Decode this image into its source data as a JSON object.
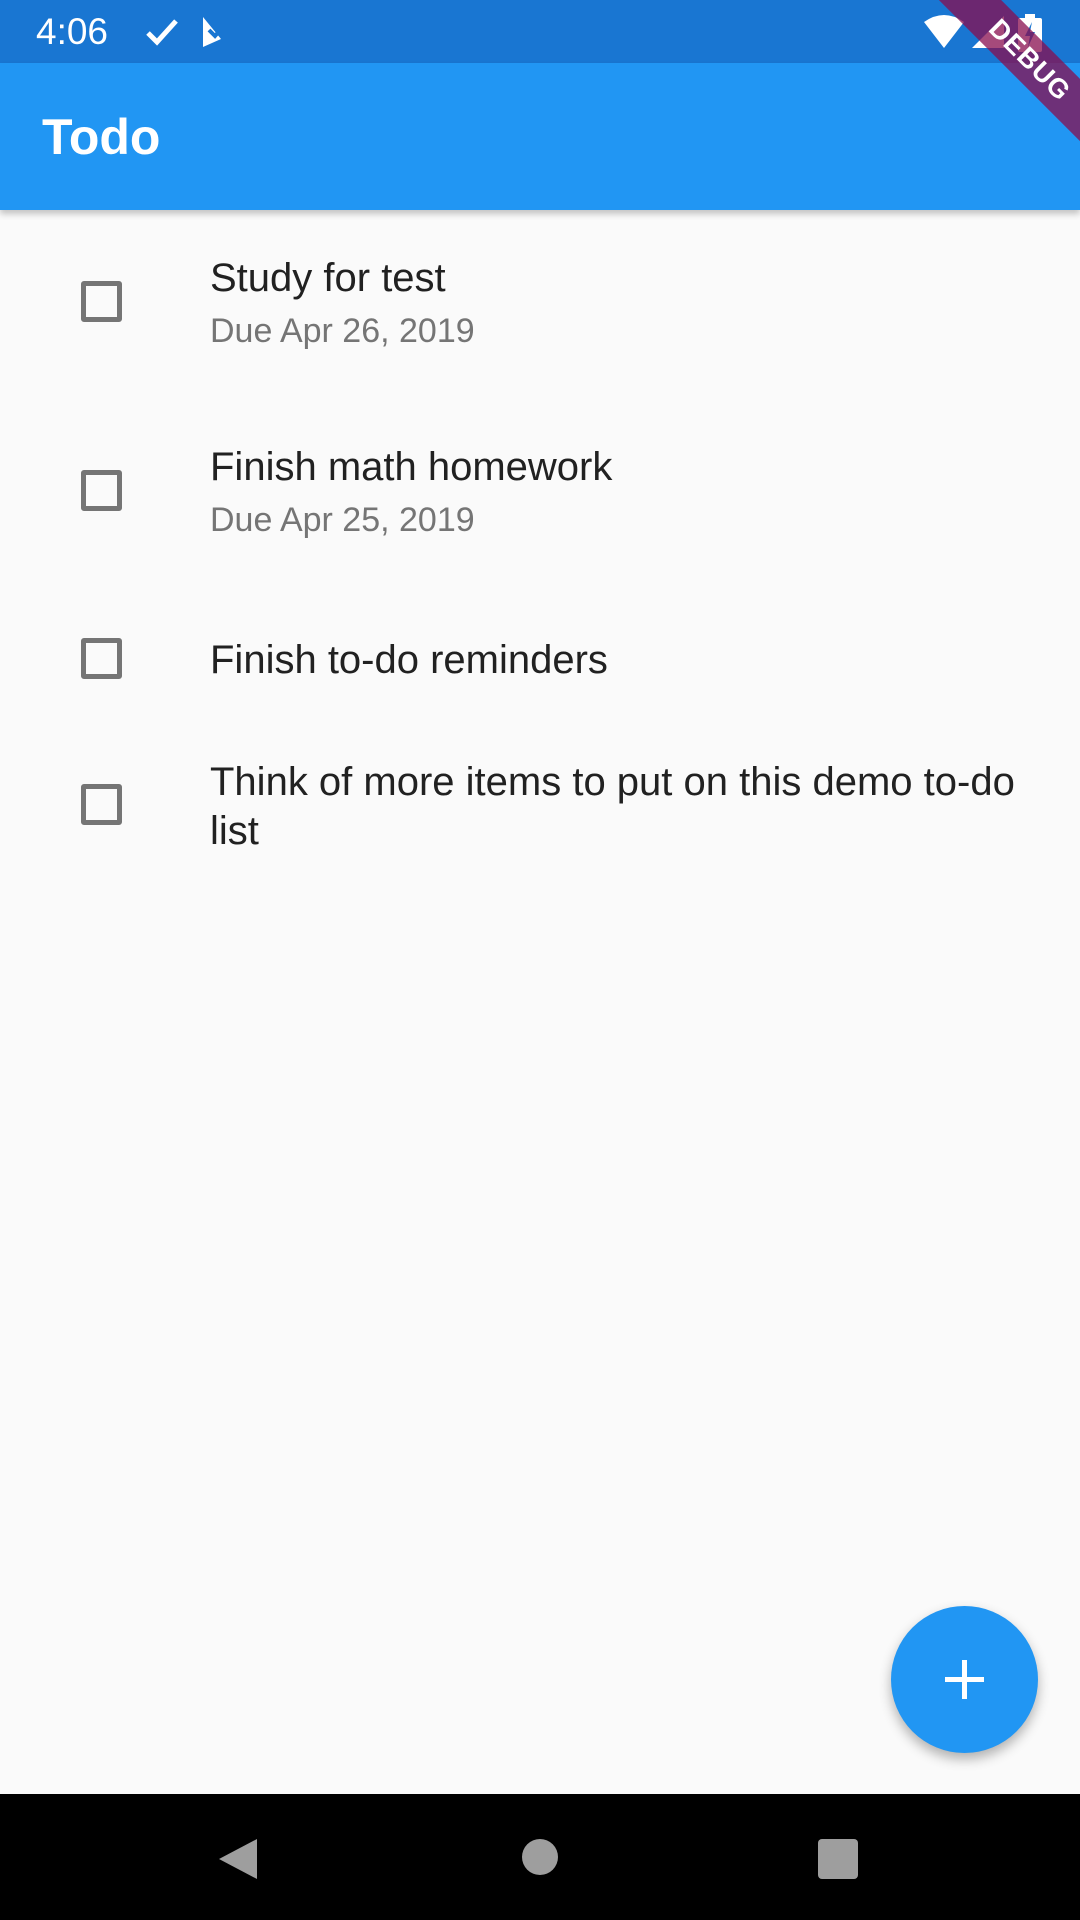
{
  "status_bar": {
    "time": "4:06",
    "icons": [
      "check-icon",
      "tasks-icon",
      "wifi-icon",
      "cellular-icon",
      "battery-icon"
    ]
  },
  "app_bar": {
    "title": "Todo"
  },
  "debug_banner": {
    "label": "DEBUG"
  },
  "todos": [
    {
      "title": "Study for test",
      "due": "Due Apr 26, 2019",
      "checked": false
    },
    {
      "title": "Finish math homework",
      "due": "Due Apr 25, 2019",
      "checked": false
    },
    {
      "title": "Finish to-do reminders",
      "checked": false
    },
    {
      "title": "Think of more items to put on this demo to-do list",
      "checked": false
    }
  ],
  "fab": {
    "icon": "add-icon"
  },
  "nav_bar": {
    "icons": [
      "back-icon",
      "home-icon",
      "recents-icon"
    ]
  },
  "colors": {
    "primary": "#2196f3",
    "primary_dark": "#1976d2",
    "background": "#fafafa",
    "text_primary": "#212121",
    "text_secondary": "#757575",
    "debug_ribbon": "#880e4f"
  }
}
